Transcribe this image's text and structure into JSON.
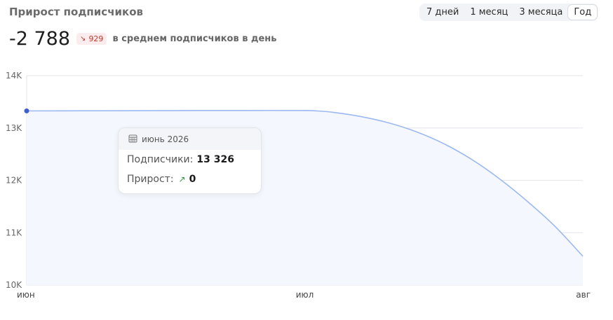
{
  "header": {
    "title": "Прирост подписчиков",
    "tabs": [
      {
        "label": "7 дней",
        "active": false
      },
      {
        "label": "1 месяц",
        "active": false
      },
      {
        "label": "3 месяца",
        "active": false
      },
      {
        "label": "Год",
        "active": true
      }
    ]
  },
  "summary": {
    "value": "-2 788",
    "badge_value": "929",
    "badge_icon": "arrow-down-right-icon",
    "caption": "в среднем подписчиков в день"
  },
  "tooltip": {
    "date": "июнь 2026",
    "subscribers_label": "Подписчики:",
    "subscribers_value": "13 326",
    "growth_label": "Прирост:",
    "growth_value": "0"
  },
  "colors": {
    "line": "#9cb9f0",
    "fill": "#f4f7fd",
    "marker": "#3f5fd0",
    "grid": "#e4e6ea",
    "negative": "#c0392b",
    "positive": "#2e9a3a"
  },
  "chart_data": {
    "type": "area",
    "x_ticks": [
      "июн",
      "июл",
      "авг"
    ],
    "y_ticks": [
      "10K",
      "11K",
      "12K",
      "13K",
      "14K"
    ],
    "ylim": [
      10000,
      14000
    ],
    "x": [
      0,
      0.1,
      0.2,
      0.3,
      0.4,
      0.5,
      0.52,
      0.55,
      0.6,
      0.65,
      0.7,
      0.75,
      0.8,
      0.85,
      0.9,
      0.95,
      1.0
    ],
    "values": [
      13326,
      13328,
      13330,
      13333,
      13334,
      13334,
      13327,
      13300,
      13220,
      13100,
      12930,
      12700,
      12400,
      12030,
      11600,
      11120,
      10550
    ],
    "grid": true,
    "legend": "none"
  }
}
